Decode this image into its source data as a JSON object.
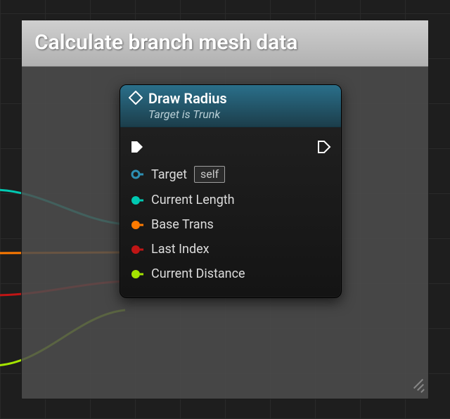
{
  "comment": {
    "title": "Calculate branch mesh data"
  },
  "node": {
    "title": "Draw Radius",
    "subtitle": "Target is Trunk",
    "pins": {
      "target": {
        "label": "Target",
        "default": "self",
        "color": "#2d8fb3"
      },
      "current_length": {
        "label": "Current Length",
        "color": "#00c9b2"
      },
      "base_trans": {
        "label": "Base Trans",
        "color": "#ff7a00"
      },
      "last_index": {
        "label": "Last Index",
        "color": "#c01515"
      },
      "current_distance": {
        "label": "Current Distance",
        "color": "#a4e400"
      }
    }
  },
  "wires": {
    "teal": "#00c9b2",
    "orange": "#ff7a00",
    "red": "#c01515",
    "green": "#a4e400"
  }
}
